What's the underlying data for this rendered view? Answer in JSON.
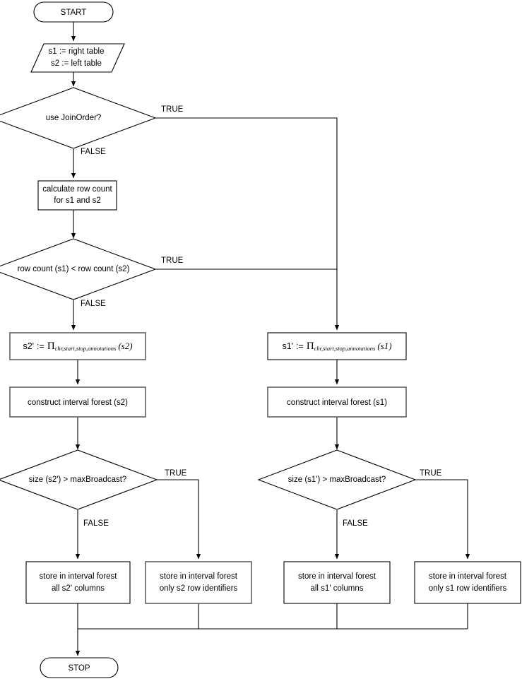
{
  "diagram": {
    "title": "Join order and broadcast decision flowchart",
    "colors": {
      "background": "#ffffff",
      "stroke": "#000000",
      "stroke_muted": "#606060",
      "text": "#000000"
    },
    "nodes": {
      "start": {
        "label": "START",
        "shape": "terminal"
      },
      "init": {
        "line1": "s1 := right table",
        "line2": "s2 := left table",
        "shape": "input-output"
      },
      "use_join_order": {
        "label": "use JoinOrder?",
        "shape": "decision"
      },
      "calc_row_count": {
        "line1": "calculate row count",
        "line2": "for s1 and s2",
        "shape": "process"
      },
      "compare_row_count": {
        "label": "row count (s1) < row count (s2)",
        "shape": "decision"
      },
      "project_s2": {
        "lhs": "s2'",
        "assign": ":=",
        "operator": "Π",
        "subscript": "chr,start,stop,annotations",
        "argument": "(s2)",
        "shape": "process"
      },
      "project_s1": {
        "lhs": "s1'",
        "assign": ":=",
        "operator": "Π",
        "subscript": "chr,start,stop,annotations",
        "argument": "(s1)",
        "shape": "process"
      },
      "construct_forest_s2": {
        "label": "construct interval forest (s2)",
        "shape": "process"
      },
      "construct_forest_s1": {
        "label": "construct interval forest (s1)",
        "shape": "process"
      },
      "size_s2_check": {
        "label": "size (s2') > maxBroadcast?",
        "shape": "decision"
      },
      "size_s1_check": {
        "label": "size (s1') > maxBroadcast?",
        "shape": "decision"
      },
      "store_s2_all": {
        "line1": "store in interval forest",
        "line2": "all s2' columns",
        "shape": "process"
      },
      "store_s2_ids": {
        "line1": "store in interval forest",
        "line2": "only s2 row identifiers",
        "shape": "process"
      },
      "store_s1_all": {
        "line1": "store in interval forest",
        "line2": "all s1' columns",
        "shape": "process"
      },
      "store_s1_ids": {
        "line1": "store in interval forest",
        "line2": "only s1 row identifiers",
        "shape": "process"
      },
      "stop": {
        "label": "STOP",
        "shape": "terminal"
      }
    },
    "edge_labels": {
      "join_order_true": "TRUE",
      "join_order_false": "FALSE",
      "row_count_true": "TRUE",
      "row_count_false": "FALSE",
      "size_s2_true": "TRUE",
      "size_s2_false": "FALSE",
      "size_s1_true": "TRUE",
      "size_s1_false": "FALSE"
    }
  }
}
